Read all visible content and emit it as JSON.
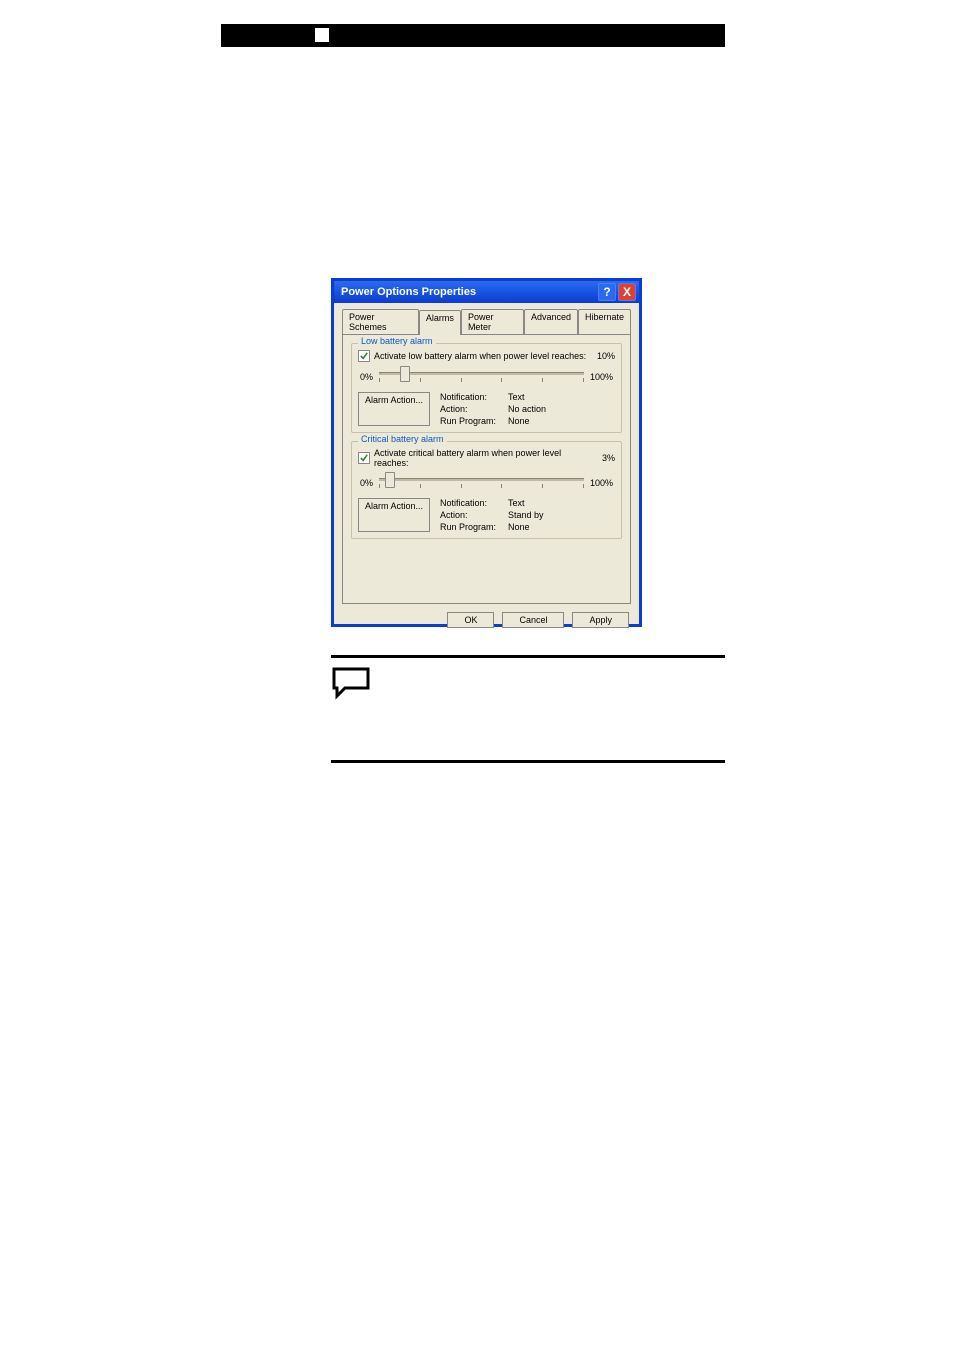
{
  "dialog": {
    "title": "Power Options Properties",
    "tabs": {
      "power_schemes": "Power Schemes",
      "alarms": "Alarms",
      "power_meter": "Power Meter",
      "advanced": "Advanced",
      "hibernate": "Hibernate"
    },
    "low": {
      "legend": "Low battery alarm",
      "chk_label": "Activate low battery alarm when power level reaches:",
      "pct": "10%",
      "slider_min": "0%",
      "slider_max": "100%",
      "btn": "Alarm Action...",
      "kv": {
        "notif_k": "Notification:",
        "notif_v": "Text",
        "action_k": "Action:",
        "action_v": "No action",
        "run_k": "Run Program:",
        "run_v": "None"
      }
    },
    "crit": {
      "legend": "Critical battery alarm",
      "chk_label": "Activate critical battery alarm when power level reaches:",
      "pct": "3%",
      "slider_min": "0%",
      "slider_max": "100%",
      "btn": "Alarm Action...",
      "kv": {
        "notif_k": "Notification:",
        "notif_v": "Text",
        "action_k": "Action:",
        "action_v": "Stand by",
        "run_k": "Run Program:",
        "run_v": "None"
      }
    },
    "buttons": {
      "ok": "OK",
      "cancel": "Cancel",
      "apply": "Apply"
    },
    "help_glyph": "?",
    "close_glyph": "X"
  }
}
